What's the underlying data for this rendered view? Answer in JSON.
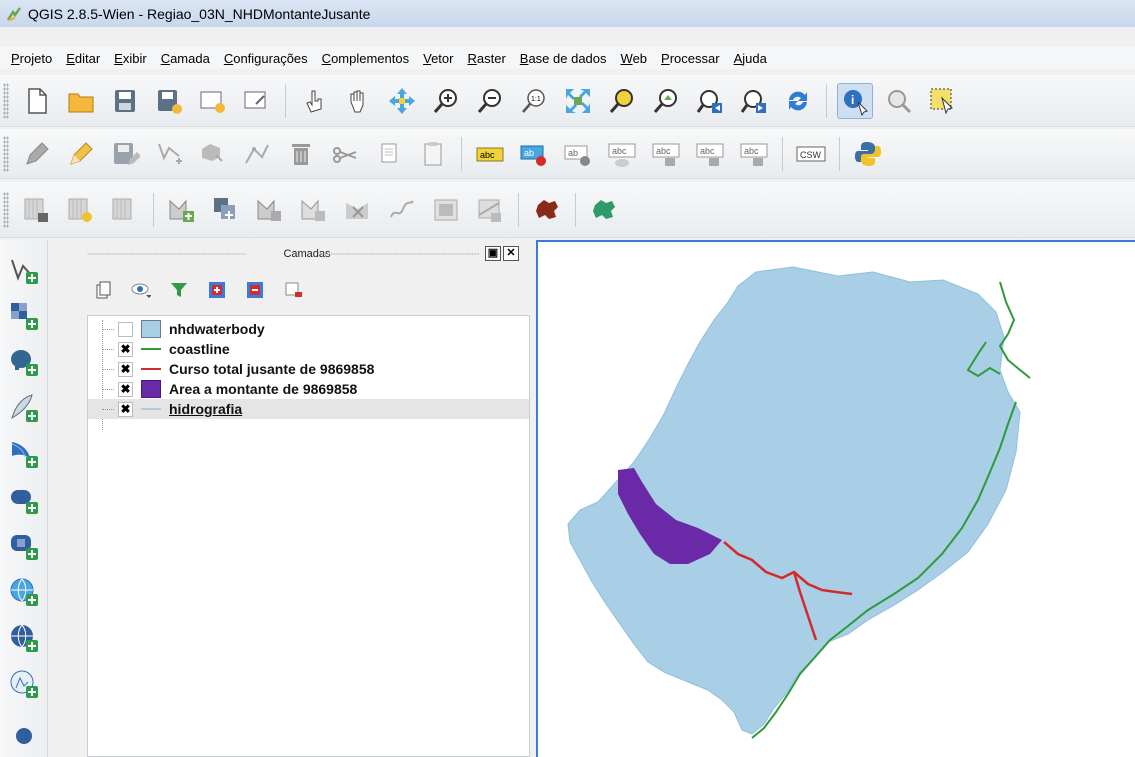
{
  "window": {
    "title": "QGIS 2.8.5-Wien - Regiao_03N_NHDMontanteJusante"
  },
  "menu": [
    "Projeto",
    "Editar",
    "Exibir",
    "Camada",
    "Configurações",
    "Complementos",
    "Vetor",
    "Raster",
    "Base de dados",
    "Web",
    "Processar",
    "Ajuda"
  ],
  "toolbar_labels": {
    "csw": "CSW",
    "abc": "abc",
    "ab": "ab"
  },
  "layers_panel": {
    "title": "Camadas",
    "layers": [
      {
        "name": "nhdwaterbody",
        "checked": false,
        "symbol": "fill",
        "color": "#a8cfe6",
        "mark": ""
      },
      {
        "name": "coastline",
        "checked": true,
        "symbol": "line",
        "color": "#2e9a3a",
        "mark": "✖"
      },
      {
        "name": "Curso total jusante de 9869858",
        "checked": true,
        "symbol": "line",
        "color": "#d42a2a",
        "mark": "✖"
      },
      {
        "name": "Area a montante de 9869858",
        "checked": true,
        "symbol": "fill",
        "color": "#6a2aa8",
        "mark": "✖"
      },
      {
        "name": "hidrografia",
        "checked": true,
        "symbol": "line",
        "color": "#a8cfe6",
        "mark": "✖"
      }
    ]
  },
  "colors": {
    "water": "#a8cfe6",
    "coastline": "#2e9a3a",
    "downstream": "#d42a2a",
    "upstream": "#6a2aa8",
    "accent": "#3a7ad9"
  }
}
